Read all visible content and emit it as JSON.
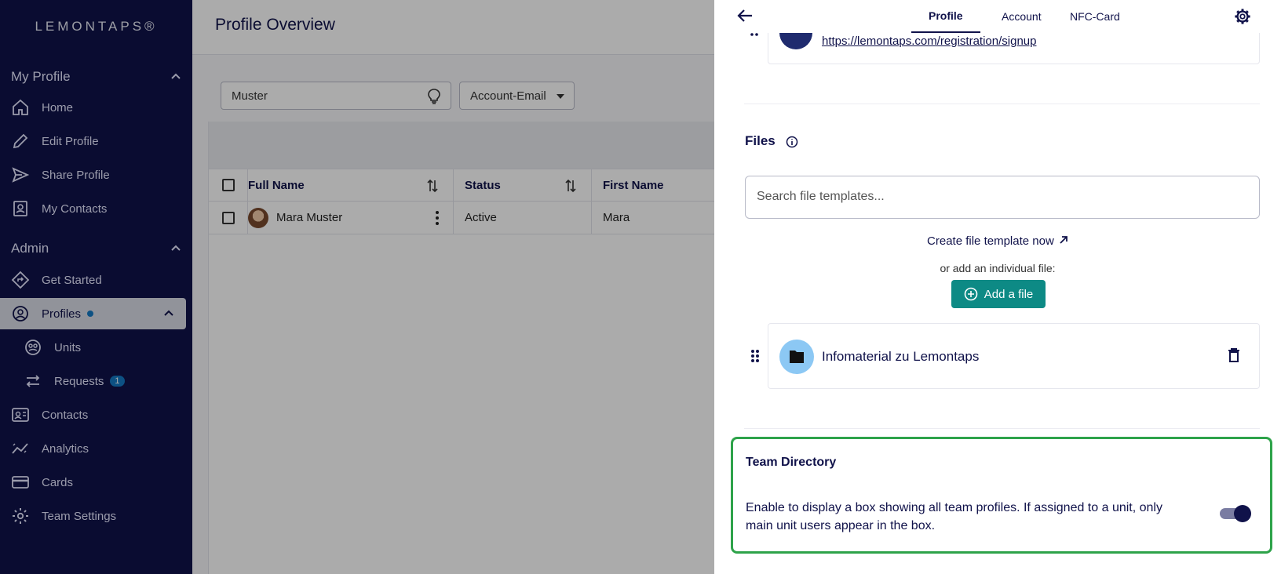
{
  "sidebar": {
    "logo": "LEMONTAPS®",
    "my_profile_heading": "My Profile",
    "my_profile_items": [
      "Home",
      "Edit Profile",
      "Share Profile",
      "My Contacts"
    ],
    "admin_heading": "Admin",
    "get_started": "Get Started",
    "profiles": "Profiles",
    "units": "Units",
    "requests": "Requests",
    "requests_count": "1",
    "contacts": "Contacts",
    "analytics": "Analytics",
    "cards": "Cards",
    "team_settings": "Team Settings"
  },
  "main": {
    "page_title": "Profile Overview",
    "search_value": "Muster",
    "filter_select": "Account-Email",
    "columns": [
      "Full Name",
      "Status",
      "First Name"
    ],
    "rows": [
      {
        "full_name": "Mara Muster",
        "status": "Active",
        "first_name": "Mara"
      }
    ]
  },
  "drawer": {
    "tabs": [
      "Profile",
      "Account",
      "NFC-Card"
    ],
    "active_tab": "Profile",
    "link_url": "https://lemontaps.com/registration/signup",
    "files_title": "Files",
    "file_search_placeholder": "Search file templates...",
    "create_template_link": "Create file template now",
    "or_add_text": "or add an individual file:",
    "add_file_button": "Add a file",
    "file_item_name": "Infomaterial zu Lemontaps",
    "team_directory_title": "Team Directory",
    "team_directory_desc": "Enable to display a box showing all team profiles. If assigned to a unit, only main unit users appear in the box.",
    "team_directory_enabled": true
  },
  "colors": {
    "sidebar_bg": "#10124a",
    "accent_teal": "#0d8a85",
    "highlight_green": "#2ea34a",
    "badge_blue": "#1479c4"
  }
}
